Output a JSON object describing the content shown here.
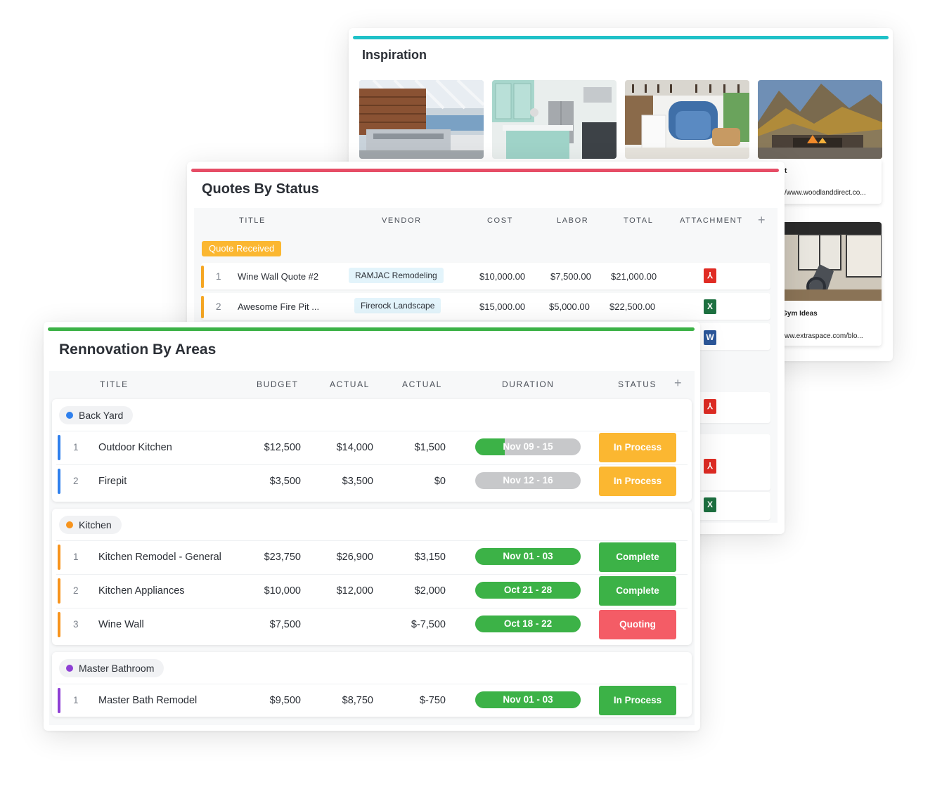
{
  "inspiration": {
    "title": "Inspiration",
    "accent": "#1fc1c8",
    "side_items": [
      {
        "title": "t",
        "url": "/www.woodlanddirect.co..."
      },
      {
        "title": ": Gym Ideas",
        "url": "/www.extraspace.com/blo..."
      }
    ]
  },
  "quotes": {
    "title": "Quotes By Status",
    "accent": "#e64d66",
    "columns": [
      "TITLE",
      "VENDOR",
      "COST",
      "LABOR",
      "TOTAL",
      "ATTACHMENT"
    ],
    "add_icon": "+",
    "group_label": "Quote Received",
    "rows": [
      {
        "num": "1",
        "title": "Wine Wall Quote #2",
        "vendor": "RAMJAC Remodeling",
        "cost": "$10,000.00",
        "labor": "$7,500.00",
        "total": "$21,000.00",
        "attachment": "pdf-icon"
      },
      {
        "num": "2",
        "title": "Awesome Fire Pit ...",
        "vendor": "Firerock Landscape",
        "cost": "$15,000.00",
        "labor": "$5,000.00",
        "total": "$22,500.00",
        "attachment": "excel-icon"
      }
    ],
    "extra_icons": {
      "word": "W",
      "excel": "X"
    }
  },
  "renovation": {
    "title": "Rennovation By Areas",
    "accent": "#3cb247",
    "columns": [
      "TITLE",
      "BUDGET",
      "ACTUAL",
      "ACTUAL",
      "DURATION",
      "STATUS"
    ],
    "add_icon": "+",
    "groups": [
      {
        "name": "Back Yard",
        "color": "#2f80ed",
        "rows": [
          {
            "num": "1",
            "title": "Outdoor Kitchen",
            "budget": "$12,500",
            "actual": "$14,000",
            "actual2": "$1,500",
            "duration": "Nov 09 - 15",
            "progress": 0.28,
            "status": "In Process",
            "status_color": "#fbb731"
          },
          {
            "num": "2",
            "title": "Firepit",
            "budget": "$3,500",
            "actual": "$3,500",
            "actual2": "$0",
            "duration": "Nov 12 - 16",
            "progress": 0,
            "status": "In Process",
            "status_color": "#fbb731"
          }
        ]
      },
      {
        "name": "Kitchen",
        "color": "#f7941d",
        "rows": [
          {
            "num": "1",
            "title": "Kitchen Remodel - General",
            "budget": "$23,750",
            "actual": "$26,900",
            "actual2": "$3,150",
            "duration": "Nov 01 - 03",
            "progress": 1,
            "status": "Complete",
            "status_color": "#3cb247"
          },
          {
            "num": "2",
            "title": "Kitchen Appliances",
            "budget": "$10,000",
            "actual": "$12,000",
            "actual2": "$2,000",
            "duration": "Oct 21 - 28",
            "progress": 1,
            "status": "Complete",
            "status_color": "#3cb247"
          },
          {
            "num": "3",
            "title": "Wine Wall",
            "budget": "$7,500",
            "actual": "",
            "actual2": "$-7,500",
            "duration": "Oct 18 - 22",
            "progress": 1,
            "status": "Quoting",
            "status_color": "#f45c66"
          }
        ]
      },
      {
        "name": "Master Bathroom",
        "color": "#8e3fd4",
        "rows": [
          {
            "num": "1",
            "title": "Master Bath Remodel",
            "budget": "$9,500",
            "actual": "$8,750",
            "actual2": "$-750",
            "duration": "Nov 01 - 03",
            "progress": 1,
            "status": "In Process",
            "status_color": "#3cb247"
          }
        ]
      }
    ]
  }
}
